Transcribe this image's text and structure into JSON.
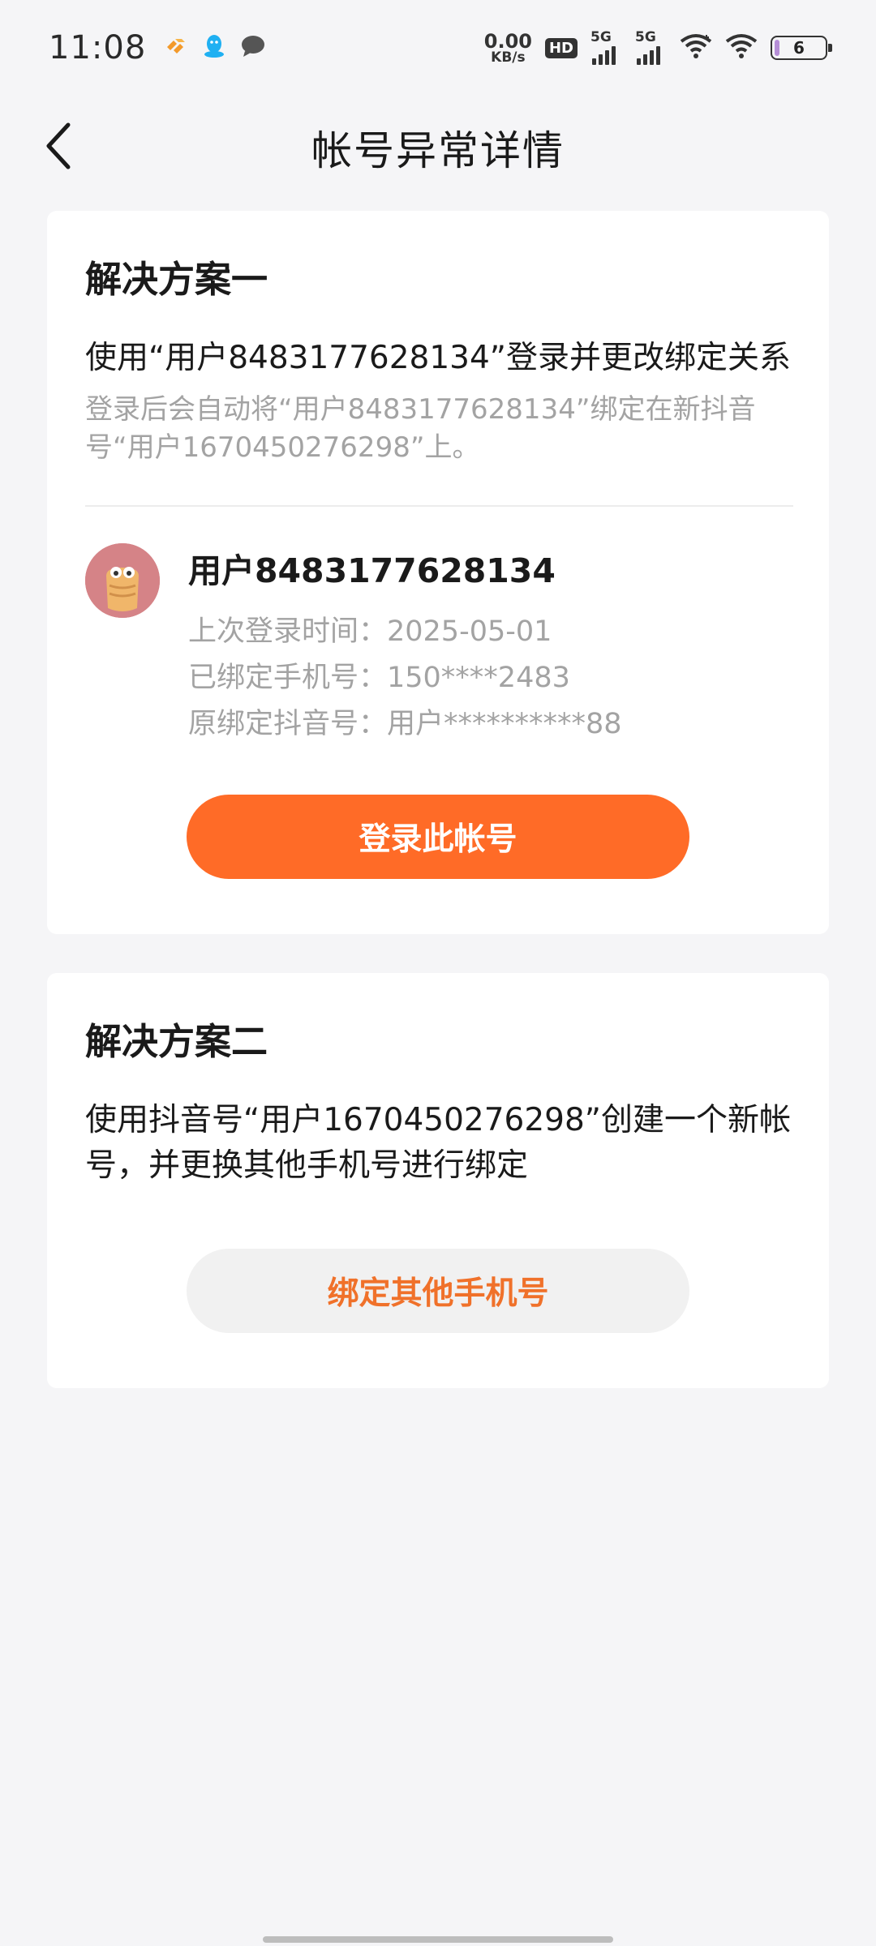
{
  "status_bar": {
    "time": "11:08",
    "net_speed_value": "0.00",
    "net_speed_unit": "KB/s",
    "hd_label": "HD",
    "sim1_label": "5G",
    "sim2_label": "5G",
    "battery_level": "6",
    "icons": [
      "app-notification-icon",
      "qq-icon",
      "message-icon",
      "hd-icon",
      "signal-icon",
      "wifi-icon",
      "battery-icon"
    ]
  },
  "header": {
    "title": "帐号异常详情",
    "back_icon": "chevron-left-icon"
  },
  "solution_one": {
    "title": "解决方案一",
    "description": "使用“用户8483177628134”登录并更改绑定关系",
    "note": "登录后会自动将“用户8483177628134”绑定在新抖音号“用户1670450276298”上。",
    "account": {
      "name": "用户8483177628134",
      "last_login": "上次登录时间：2025-05-01",
      "bound_phone": "已绑定手机号：150****2483",
      "original_douyin": "原绑定抖音号：用户**********88"
    },
    "button_label": "登录此帐号"
  },
  "solution_two": {
    "title": "解决方案二",
    "description": "使用抖音号“用户1670450276298”创建一个新帐号，并更换其他手机号进行绑定",
    "button_label": "绑定其他手机号"
  },
  "colors": {
    "accent": "#ff6b27",
    "background": "#f5f5f7",
    "card": "#ffffff",
    "secondary_text": "#a3a3a3"
  }
}
